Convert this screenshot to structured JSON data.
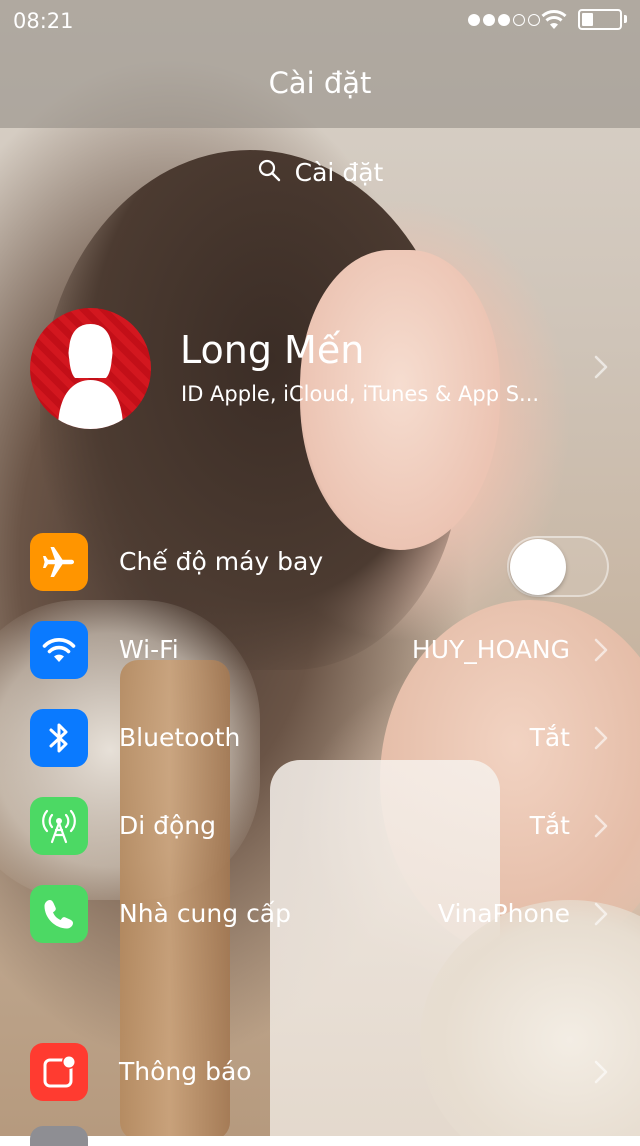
{
  "status_bar": {
    "time": "08:21",
    "signal_bars_filled": 3,
    "signal_bars_total": 5,
    "battery_level": 0.3
  },
  "nav": {
    "title": "Cài đặt"
  },
  "search": {
    "placeholder": "Cài đặt",
    "icon": "search-icon"
  },
  "profile": {
    "name": "Long Mến",
    "subtitle": "ID Apple, iCloud, iTunes & App S..."
  },
  "settings": {
    "airplane": {
      "label": "Chế độ máy bay",
      "icon": "airplane-icon",
      "color": "#ff9500",
      "enabled": false
    },
    "wifi": {
      "label": "Wi-Fi",
      "value": "HUY_HOANG",
      "icon": "wifi-icon",
      "color": "#0a7aff"
    },
    "bluetooth": {
      "label": "Bluetooth",
      "value": "Tắt",
      "icon": "bluetooth-icon",
      "color": "#0a7aff"
    },
    "cellular": {
      "label": "Di động",
      "value": "Tắt",
      "icon": "cellular-antenna-icon",
      "color": "#4cd964"
    },
    "carrier": {
      "label": "Nhà cung cấp",
      "value": "VinaPhone",
      "icon": "phone-icon",
      "color": "#4cd964"
    },
    "notifications": {
      "label": "Thông báo",
      "icon": "notifications-icon",
      "color": "#ff3b30"
    }
  }
}
